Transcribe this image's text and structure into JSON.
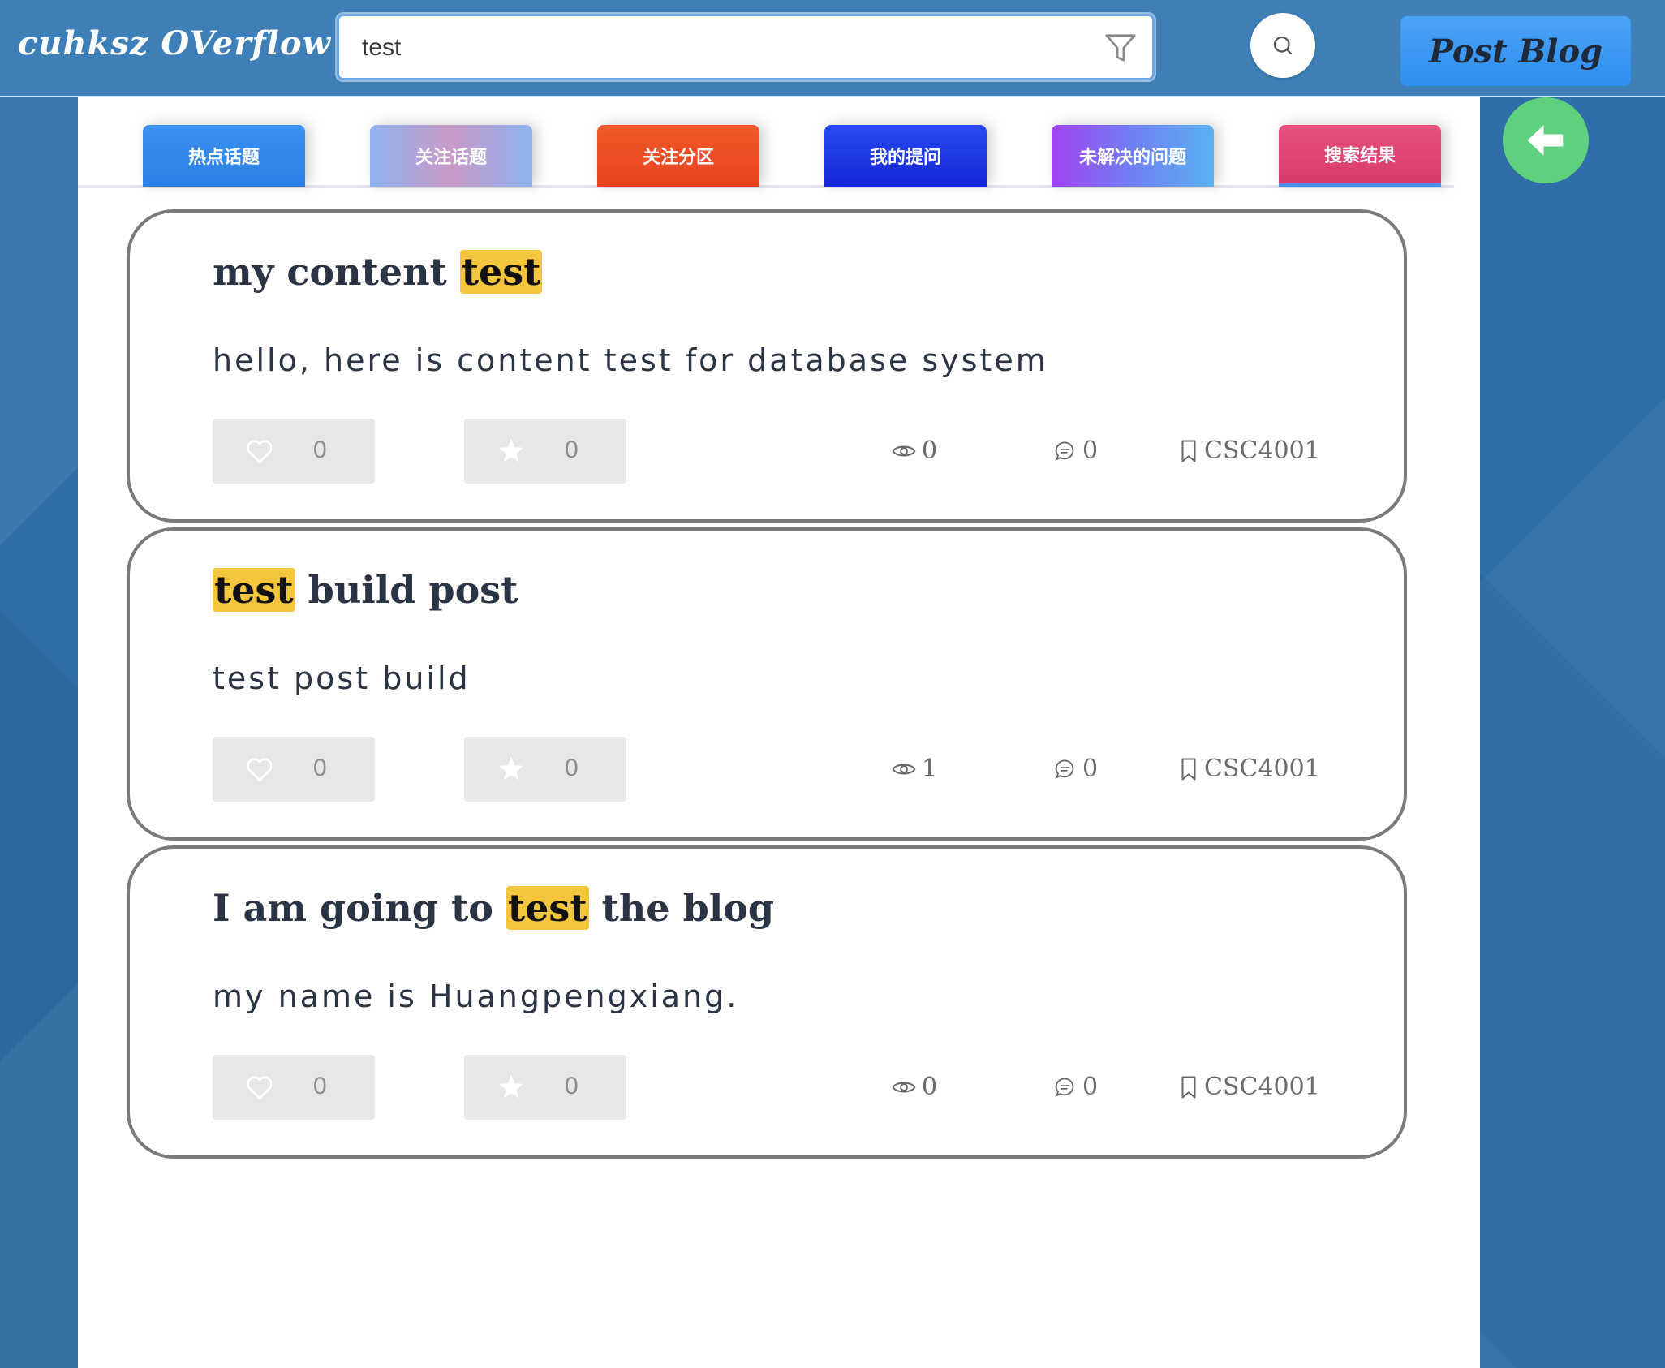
{
  "header": {
    "logo": "cuhksz OVerflow",
    "search": {
      "value": "test",
      "placeholder": ""
    },
    "filter_icon": "filter-icon",
    "search_icon": "search-icon",
    "post_blog_label": "Post Blog"
  },
  "tabs": [
    {
      "label": "热点话题"
    },
    {
      "label": "关注话题"
    },
    {
      "label": "关注分区"
    },
    {
      "label": "我的提问"
    },
    {
      "label": "未解决的问题"
    },
    {
      "label": "搜索结果"
    }
  ],
  "highlight_color": "#f4c63d",
  "posts": [
    {
      "title_before": "my content ",
      "title_highlight": "test",
      "title_after": "",
      "body": "hello, here is content test for database system",
      "likes": "0",
      "favorites": "0",
      "views": "0",
      "comments": "0",
      "tag": "CSC4001"
    },
    {
      "title_before": "",
      "title_highlight": "test",
      "title_after": " build post",
      "body": "test post build",
      "likes": "0",
      "favorites": "0",
      "views": "1",
      "comments": "0",
      "tag": "CSC4001"
    },
    {
      "title_before": "I am going to ",
      "title_highlight": "test",
      "title_after": " the blog",
      "body": "my name is Huangpengxiang.",
      "likes": "0",
      "favorites": "0",
      "views": "0",
      "comments": "0",
      "tag": "CSC4001"
    }
  ],
  "back_icon": "arrow-left-icon"
}
